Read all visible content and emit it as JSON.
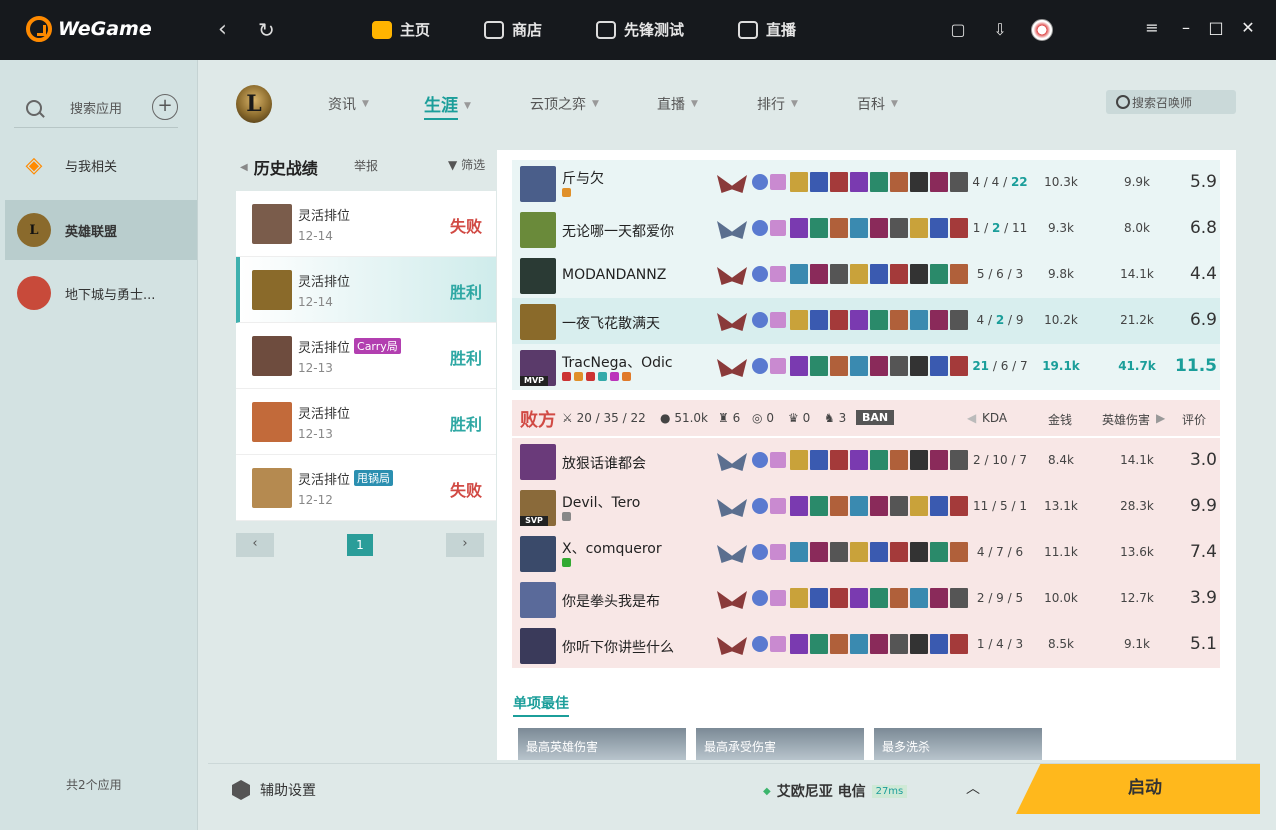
{
  "app": {
    "name": "WeGame"
  },
  "top_nav": [
    {
      "label": "主页",
      "active": true
    },
    {
      "label": "商店"
    },
    {
      "label": "先锋测试"
    },
    {
      "label": "直播"
    }
  ],
  "sidebar": {
    "search_label": "搜索应用",
    "items": [
      {
        "label": "与我相关"
      },
      {
        "label": "英雄联盟",
        "active": true
      },
      {
        "label": "地下城与勇士..."
      }
    ],
    "footer": "共2个应用"
  },
  "game_nav": {
    "logo_text": "L",
    "tabs": [
      {
        "label": "资讯"
      },
      {
        "label": "生涯",
        "active": true
      },
      {
        "label": "云顶之弈"
      },
      {
        "label": "直播"
      },
      {
        "label": "排行"
      },
      {
        "label": "百科"
      }
    ],
    "search_placeholder": "搜索召唤师"
  },
  "history": {
    "title": "历史战绩",
    "report": "举报",
    "filter": "筛选",
    "page": "1",
    "prev": "‹",
    "next": "›",
    "matches": [
      {
        "type": "灵活排位",
        "date": "12-14",
        "result": "失败",
        "win": false,
        "tag": "",
        "tag_color": "",
        "champ_color": "#7a5c4b"
      },
      {
        "type": "灵活排位",
        "date": "12-14",
        "result": "胜利",
        "win": true,
        "tag": "",
        "tag_color": "",
        "champ_color": "#8a6a2a",
        "active": true
      },
      {
        "type": "灵活排位",
        "date": "12-13",
        "result": "胜利",
        "win": true,
        "tag": "Carry局",
        "tag_color": "#b23fb0",
        "champ_color": "#6e4c3e"
      },
      {
        "type": "灵活排位",
        "date": "12-13",
        "result": "胜利",
        "win": true,
        "tag": "",
        "tag_color": "",
        "champ_color": "#c26a3a"
      },
      {
        "type": "灵活排位",
        "date": "12-12",
        "result": "失败",
        "win": false,
        "tag": "甩锅局",
        "tag_color": "#2b8fb0",
        "champ_color": "#b58a50"
      }
    ]
  },
  "detail": {
    "win_players": [
      {
        "name": "斤与欠",
        "kda": [
          "4",
          "4",
          "22"
        ],
        "kda_hi": 2,
        "gold": "10.3k",
        "damage": "9.9k",
        "score": "5.9",
        "rank": "bronze",
        "badge": "",
        "avatar": "#4a5e8a",
        "medals": [
          "#e0902a"
        ]
      },
      {
        "name": "无论哪一天都爱你",
        "kda": [
          "1",
          "2",
          "11"
        ],
        "kda_hi": 1,
        "gold": "9.3k",
        "damage": "8.0k",
        "score": "6.8",
        "rank": "silver",
        "badge": "",
        "avatar": "#6a8a3a",
        "medals": []
      },
      {
        "name": "MODANDANNZ",
        "kda": [
          "5",
          "6",
          "3"
        ],
        "kda_hi": -1,
        "gold": "9.8k",
        "damage": "14.1k",
        "score": "4.4",
        "rank": "bronze",
        "badge": "",
        "avatar": "#2a3a34",
        "medals": []
      },
      {
        "name": "一夜飞花散满天",
        "kda": [
          "4",
          "2",
          "9"
        ],
        "kda_hi": 1,
        "gold": "10.2k",
        "damage": "21.2k",
        "score": "6.9",
        "rank": "bronze",
        "badge": "",
        "avatar": "#8a6a2a",
        "medals": [],
        "highlight": true
      },
      {
        "name": "TracNega、Odic",
        "kda": [
          "21",
          "6",
          "7"
        ],
        "kda_hi": 0,
        "gold": "19.1k",
        "damage": "41.7k",
        "score": "11.5",
        "rank": "bronze",
        "badge": "MVP",
        "avatar": "#5a3a6a",
        "medals": [
          "#c33",
          "#e0902a",
          "#c33",
          "#3aa",
          "#b3b",
          "#e07a2a"
        ],
        "hi": true
      }
    ],
    "lose_header": {
      "title": "败方",
      "kda": "20 / 35 / 22",
      "gold": "51.0k",
      "towers": "6",
      "inhib": "0",
      "baron": "0",
      "dragon": "3",
      "ban": "BAN",
      "col_kda": "KDA",
      "col_gold": "金钱",
      "col_dmg": "英雄伤害",
      "col_score": "评价"
    },
    "lose_players": [
      {
        "name": "放狠话谁都会",
        "kda": [
          "2",
          "10",
          "7"
        ],
        "kda_hi": -1,
        "gold": "8.4k",
        "damage": "14.1k",
        "score": "3.0",
        "rank": "silver",
        "badge": "",
        "avatar": "#6a3a7a",
        "medals": []
      },
      {
        "name": "Devil、Tero",
        "kda": [
          "11",
          "5",
          "1"
        ],
        "kda_hi": -1,
        "gold": "13.1k",
        "damage": "28.3k",
        "score": "9.9",
        "rank": "silver",
        "badge": "SVP",
        "avatar": "#8a6a3a",
        "medals": [
          "#888"
        ]
      },
      {
        "name": "X、comqueror",
        "kda": [
          "4",
          "7",
          "6"
        ],
        "kda_hi": -1,
        "gold": "11.1k",
        "damage": "13.6k",
        "score": "7.4",
        "rank": "silver",
        "badge": "",
        "avatar": "#3a4a6a",
        "medals": [
          "#3a3"
        ]
      },
      {
        "name": "你是拳头我是布",
        "kda": [
          "2",
          "9",
          "5"
        ],
        "kda_hi": -1,
        "gold": "10.0k",
        "damage": "12.7k",
        "score": "3.9",
        "rank": "bronze",
        "badge": "",
        "avatar": "#5a6a9a",
        "medals": []
      },
      {
        "name": "你听下你讲些什么",
        "kda": [
          "1",
          "4",
          "3"
        ],
        "kda_hi": -1,
        "gold": "8.5k",
        "damage": "9.1k",
        "score": "5.1",
        "rank": "bronze",
        "badge": "",
        "avatar": "#3a3a5a",
        "medals": []
      }
    ],
    "best_title": "单项最佳",
    "best_cards": [
      "最高英雄伤害",
      "最高承受伤害",
      "最多洗杀"
    ]
  },
  "bottom": {
    "assist": "辅助设置",
    "server": "艾欧尼亚 电信",
    "ping": "27ms",
    "launch": "启动"
  }
}
